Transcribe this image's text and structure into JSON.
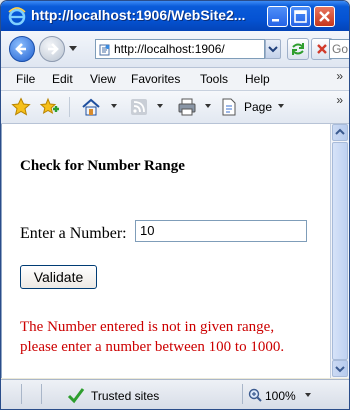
{
  "window": {
    "title": "http://localhost:1906/WebSite2..."
  },
  "address_bar": {
    "url": "http://localhost:1906/",
    "search_placeholder": "Go"
  },
  "menu": {
    "items": [
      "File",
      "Edit",
      "View",
      "Favorites",
      "Tools",
      "Help"
    ]
  },
  "toolbar": {
    "page_label": "Page"
  },
  "content": {
    "heading": "Check for Number Range",
    "enter_label": "Enter a Number:",
    "number_value": "10",
    "validate_label": "Validate",
    "error_message": "The Number entered is not in given range, please enter a number between 100 to 1000."
  },
  "status_bar": {
    "zone": "Trusted sites",
    "zoom": "100%"
  },
  "colors": {
    "title_bar": "#0553d3",
    "error_text": "#cc0000",
    "trusted_check": "#2e9e2e"
  },
  "icons": [
    "ie-logo-icon",
    "back-arrow-icon",
    "forward-arrow-icon",
    "page-icon",
    "dropdown-arrow-icon",
    "refresh-icon",
    "stop-icon",
    "favorites-star-icon",
    "add-favorite-icon",
    "home-icon",
    "rss-feed-icon",
    "print-icon",
    "page-menu-icon",
    "check-icon",
    "zoom-icon"
  ]
}
